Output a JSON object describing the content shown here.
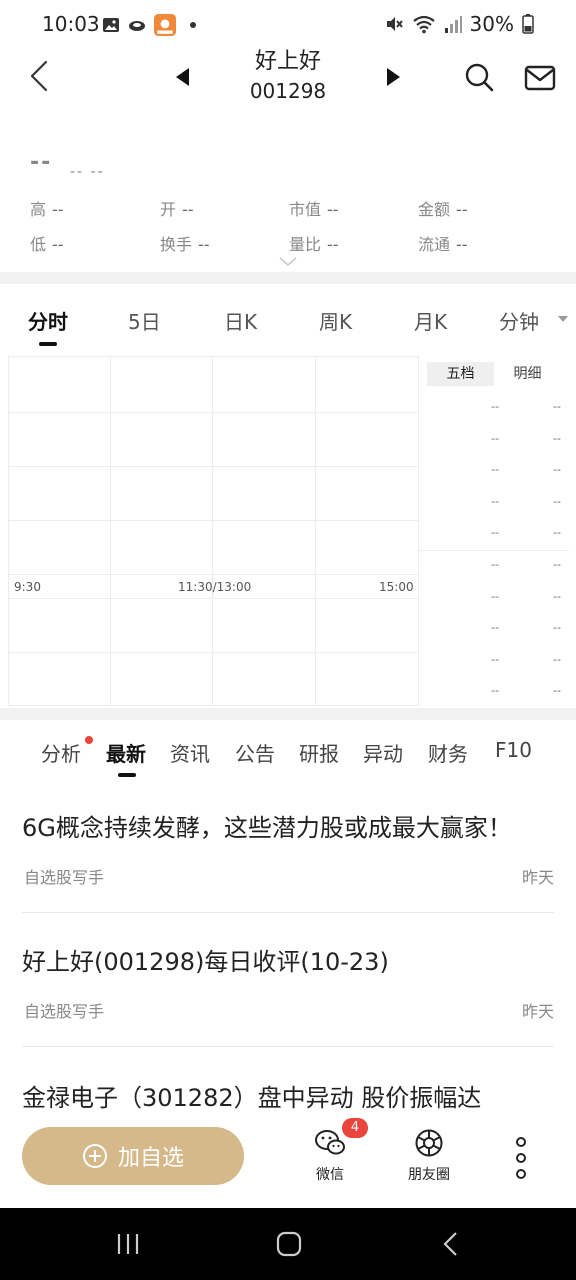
{
  "status_bar": {
    "time": "10:03",
    "battery": "30%",
    "left_icons": [
      "gallery-icon",
      "cloud-icon",
      "app-notification-icon"
    ],
    "right_icons": [
      "mute-icon",
      "wifi-icon",
      "signal-icon",
      "battery-icon"
    ]
  },
  "header": {
    "stock_name": "好上好",
    "stock_code": "001298"
  },
  "quote": {
    "price": "--",
    "change": "-- --",
    "row1": [
      {
        "label": "高",
        "value": "--"
      },
      {
        "label": "开",
        "value": "--"
      },
      {
        "label": "市值",
        "value": "--"
      },
      {
        "label": "金额",
        "value": "--"
      }
    ],
    "row2": [
      {
        "label": "低",
        "value": "--"
      },
      {
        "label": "换手",
        "value": "--"
      },
      {
        "label": "量比",
        "value": "--"
      },
      {
        "label": "流通",
        "value": "--"
      }
    ]
  },
  "chart_tabs": [
    {
      "label": "分时",
      "active": true
    },
    {
      "label": "5日"
    },
    {
      "label": "日K"
    },
    {
      "label": "周K"
    },
    {
      "label": "月K"
    },
    {
      "label": "分钟"
    }
  ],
  "chart": {
    "time_labels": [
      "9:30",
      "11:30/13:00",
      "15:00"
    ]
  },
  "depth": {
    "tabs": [
      {
        "label": "五档",
        "active": true
      },
      {
        "label": "明细"
      }
    ],
    "rows": [
      [
        "--",
        "--"
      ],
      [
        "--",
        "--"
      ],
      [
        "--",
        "--"
      ],
      [
        "--",
        "--"
      ],
      [
        "--",
        "--"
      ],
      [
        "--",
        "--"
      ],
      [
        "--",
        "--"
      ],
      [
        "--",
        "--"
      ],
      [
        "--",
        "--"
      ],
      [
        "--",
        "--"
      ]
    ]
  },
  "news_tabs": [
    {
      "label": "分析",
      "dot": true
    },
    {
      "label": "最新",
      "active": true
    },
    {
      "label": "资讯"
    },
    {
      "label": "公告"
    },
    {
      "label": "研报"
    },
    {
      "label": "异动"
    },
    {
      "label": "财务"
    },
    {
      "label": "F10"
    }
  ],
  "news": [
    {
      "title": "6G概念持续发酵，这些潜力股或成最大赢家！",
      "source": "自选股写手",
      "time": "昨天"
    },
    {
      "title": "好上好(001298)每日收评(10-23)",
      "source": "自选股写手",
      "time": "昨天"
    },
    {
      "title": "金禄电子（301282）盘中异动 股价振幅达"
    }
  ],
  "actions": {
    "add_label": "加自选",
    "wechat_label": "微信",
    "wechat_badge": "4",
    "moments_label": "朋友圈"
  },
  "colors": {
    "accent_gold": "#d5b98a",
    "badge_red": "#e8453c",
    "tab_active": "#111111"
  }
}
